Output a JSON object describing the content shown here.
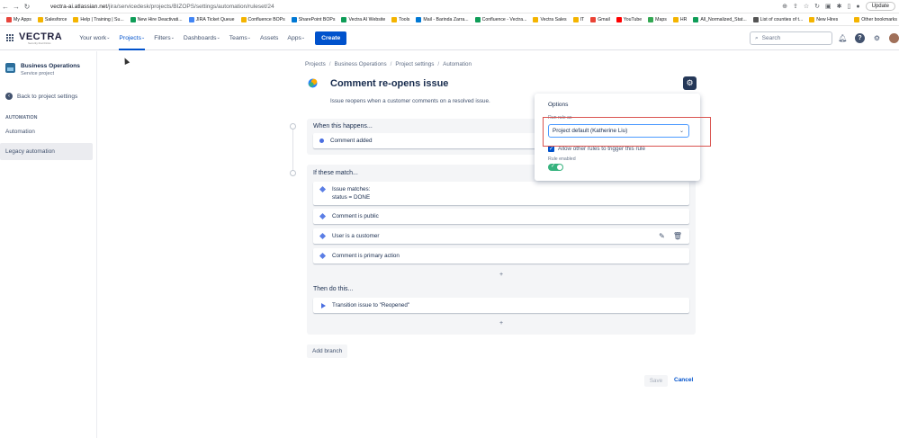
{
  "browser": {
    "url_host": "vectra-ai.atlassian.net",
    "url_path": "/jira/servicedesk/projects/BIZOPS/settings/automation/ruleset/24",
    "update_label": "Update"
  },
  "bookmarks": [
    {
      "label": "My Apps",
      "color": "#e8453c"
    },
    {
      "label": "Salesforce",
      "color": "#f4b400"
    },
    {
      "label": "Help | Training | Su...",
      "color": "#f4b400"
    },
    {
      "label": "New Hire Deactivati...",
      "color": "#0f9d58"
    },
    {
      "label": "JIRA Ticket Queue",
      "color": "#4285f4"
    },
    {
      "label": "Confluence BOPs",
      "color": "#f4b400"
    },
    {
      "label": "SharePoint BOPs",
      "color": "#0078d4"
    },
    {
      "label": "Vectra AI Website",
      "color": "#0f9d58"
    },
    {
      "label": "Tools",
      "color": "#f4b400"
    },
    {
      "label": "Mail - Barinda Zarra...",
      "color": "#0078d4"
    },
    {
      "label": "Confluence - Vectra...",
      "color": "#0f9d58"
    },
    {
      "label": "Vectra Sales",
      "color": "#f4b400"
    },
    {
      "label": "IT",
      "color": "#f4b400"
    },
    {
      "label": "Gmail",
      "color": "#ea4335"
    },
    {
      "label": "YouTube",
      "color": "#ff0000"
    },
    {
      "label": "Maps",
      "color": "#34a853"
    },
    {
      "label": "HR",
      "color": "#f4b400"
    },
    {
      "label": "All_Normalized_Stat...",
      "color": "#0f9d58"
    },
    {
      "label": "List of counties of t...",
      "color": "#555555"
    },
    {
      "label": "New Hires",
      "color": "#f4b400"
    }
  ],
  "bookmarks_other": "Other bookmarks",
  "topnav": {
    "logo": "VECTRA",
    "logo_tagline": "Security that thinks",
    "items": [
      "Your work",
      "Projects",
      "Filters",
      "Dashboards",
      "Teams",
      "Assets",
      "Apps"
    ],
    "active_index": 1,
    "create_label": "Create",
    "search_placeholder": "Search"
  },
  "sidebar": {
    "project_name": "Business Operations",
    "project_type": "Service project",
    "back_label": "Back to project settings",
    "section_label": "AUTOMATION",
    "items": [
      "Automation",
      "Legacy automation"
    ],
    "selected_index": 1
  },
  "breadcrumb": [
    "Projects",
    "Business Operations",
    "Project settings",
    "Automation"
  ],
  "rule": {
    "title": "Comment re-opens issue",
    "description": "Issue reopens when a customer comments on a resolved issue."
  },
  "trigger": {
    "heading": "When this happens...",
    "card": "Comment added"
  },
  "conditions": {
    "heading": "If these match...",
    "cards": [
      {
        "line1": "Issue matches:",
        "line2": "status = DONE"
      },
      {
        "line1": "Comment is public",
        "line2": ""
      },
      {
        "line1": "User is a customer",
        "line2": ""
      },
      {
        "line1": "Comment is primary action",
        "line2": ""
      }
    ]
  },
  "actions": {
    "heading": "Then do this...",
    "card": "Transition issue to \"Reopened\""
  },
  "add_branch_label": "Add branch",
  "save_label": "Save",
  "cancel_label": "Cancel",
  "options": {
    "title": "Options",
    "run_as_label": "Run rule as",
    "run_as_value": "Project default (Katherine Liu)",
    "allow_other_label": "Allow other rules to trigger this rule",
    "allow_other_checked": true,
    "rule_enabled_label": "Rule enabled",
    "rule_enabled": true
  }
}
